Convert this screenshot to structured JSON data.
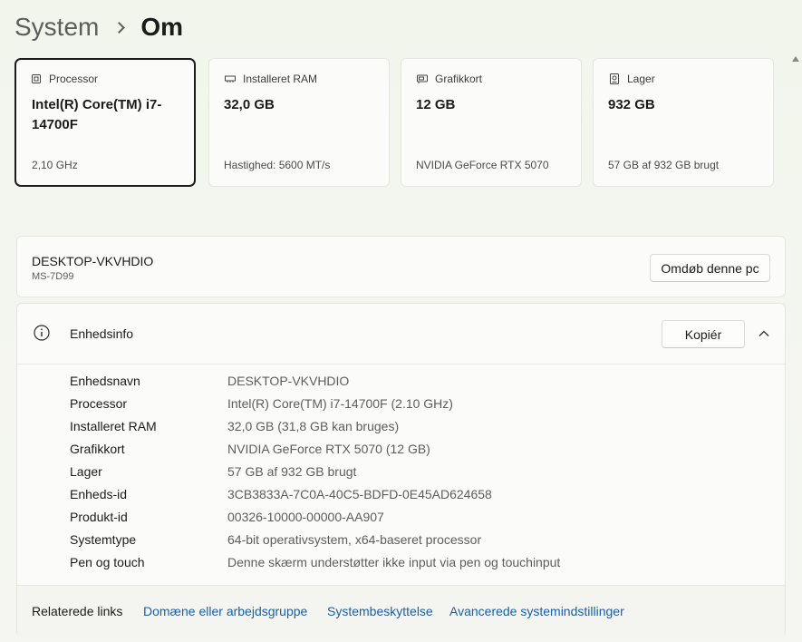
{
  "breadcrumb": {
    "parent": "System",
    "current": "Om"
  },
  "cards": [
    {
      "icon": "processor-icon",
      "title": "Processor",
      "value": "Intel(R) Core(TM) i7-14700F",
      "sub": "2,10 GHz"
    },
    {
      "icon": "ram-icon",
      "title": "Installeret RAM",
      "value": "32,0 GB",
      "sub": "Hastighed: 5600 MT/s"
    },
    {
      "icon": "graphics-card-icon",
      "title": "Grafikkort",
      "value": "12 GB",
      "sub": "NVIDIA GeForce RTX 5070"
    },
    {
      "icon": "storage-icon",
      "title": "Lager",
      "value": "932 GB",
      "sub": "57 GB af 932 GB brugt"
    }
  ],
  "pc": {
    "name": "DESKTOP-VKVHDIO",
    "model": "MS-7D99",
    "rename_label": "Omdøb denne pc"
  },
  "device_info": {
    "title": "Enhedsinfo",
    "copy_label": "Kopiér",
    "rows": [
      {
        "label": "Enhedsnavn",
        "value": "DESKTOP-VKVHDIO"
      },
      {
        "label": "Processor",
        "value": "Intel(R) Core(TM) i7-14700F (2.10 GHz)"
      },
      {
        "label": "Installeret RAM",
        "value": "32,0 GB (31,8 GB kan bruges)"
      },
      {
        "label": "Grafikkort",
        "value": "NVIDIA GeForce RTX 5070 (12 GB)"
      },
      {
        "label": "Lager",
        "value": "57 GB af 932 GB brugt"
      },
      {
        "label": "Enheds-id",
        "value": "3CB3833A-7C0A-40C5-BDFD-0E45AD624658"
      },
      {
        "label": "Produkt-id",
        "value": "00326-10000-00000-AA907"
      },
      {
        "label": "Systemtype",
        "value": "64-bit operativsystem, x64-baseret processor"
      },
      {
        "label": "Pen og touch",
        "value": "Denne skærm understøtter ikke input via pen og touchinput"
      }
    ]
  },
  "related_links": {
    "label": "Relaterede links",
    "links": [
      "Domæne eller arbejdsgruppe",
      "Systembeskyttelse",
      "Avancerede systemindstillinger"
    ]
  },
  "colors": {
    "link": "#1a5fa8",
    "selected_border": "#1b1b1b"
  }
}
